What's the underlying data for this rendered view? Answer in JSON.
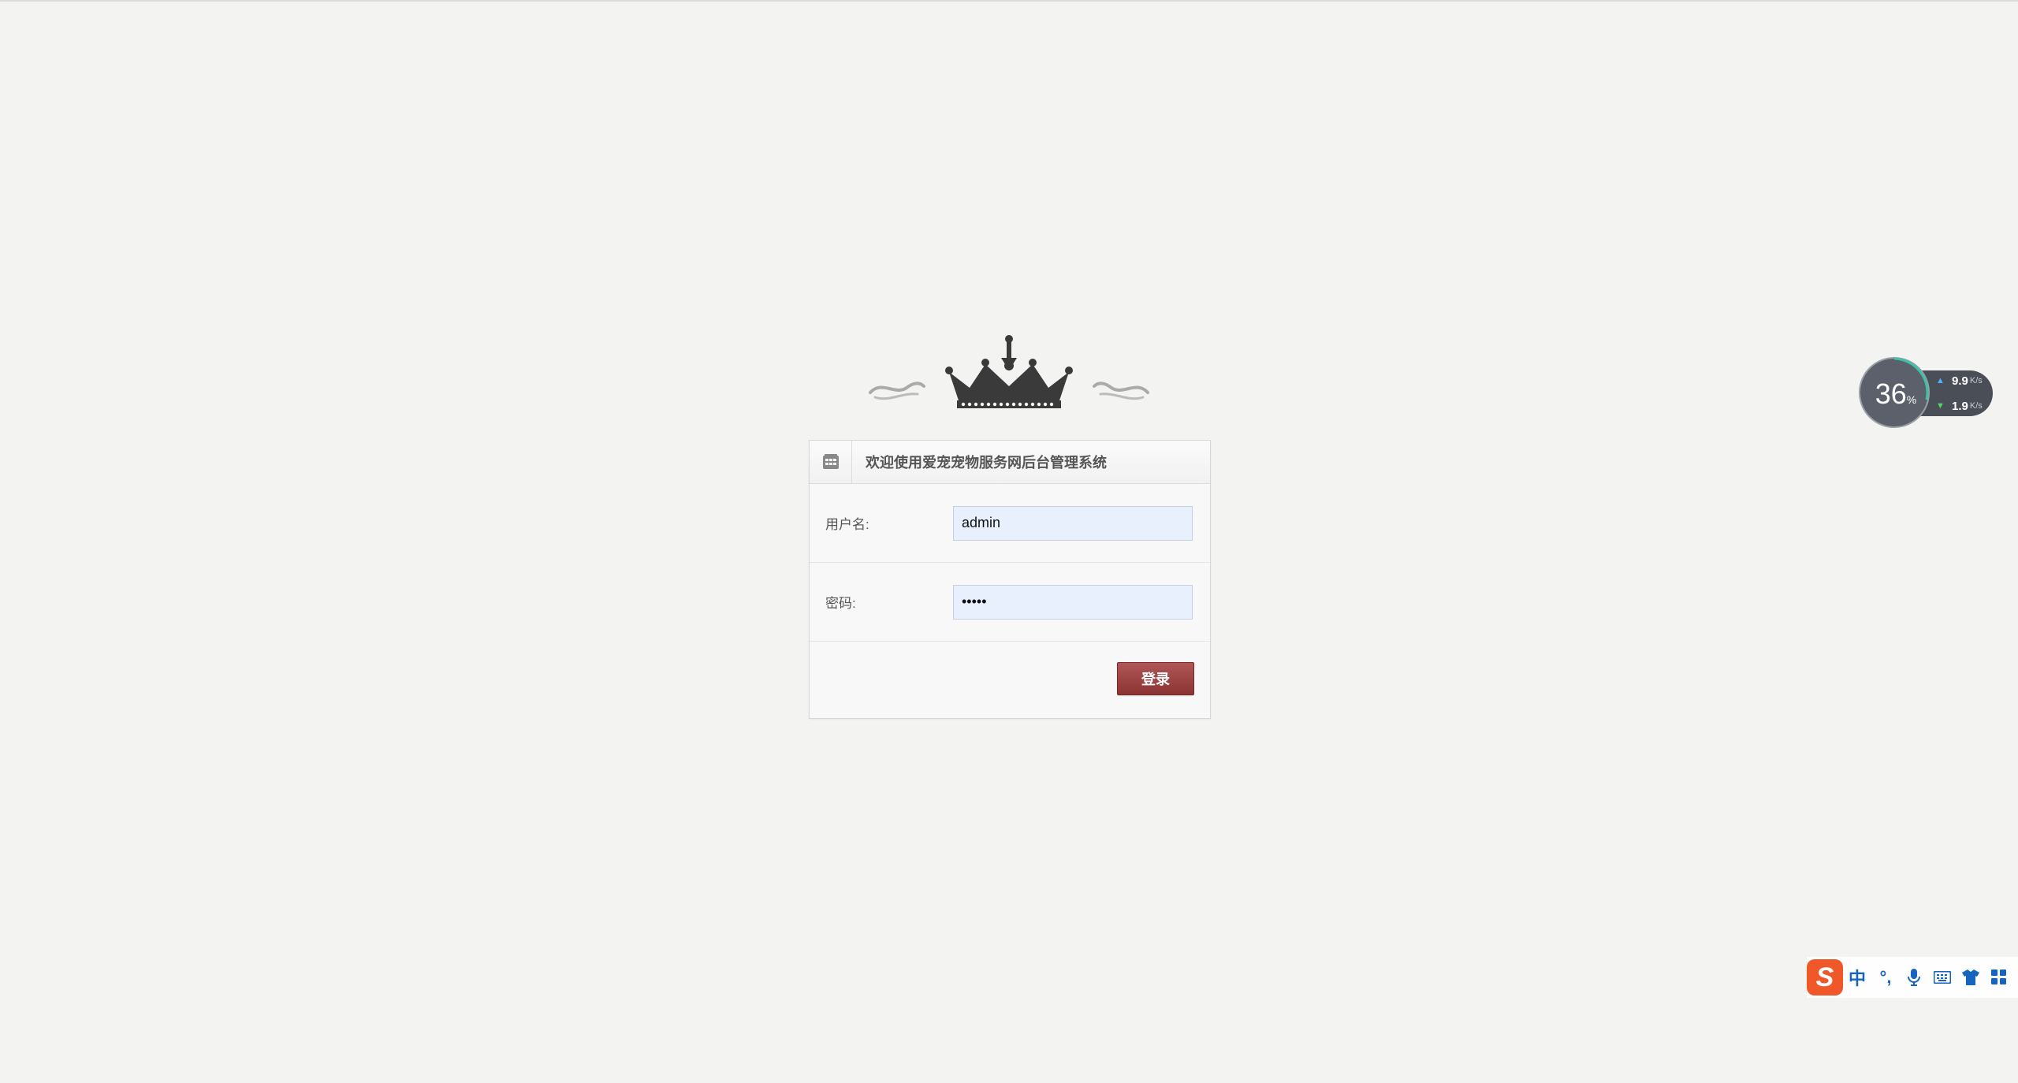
{
  "login": {
    "title": "欢迎使用爱宠宠物服务网后台管理系统",
    "username_label": "用户名:",
    "username_value": "admin",
    "password_label": "密码:",
    "password_value": "•••••",
    "submit_label": "登录"
  },
  "net_widget": {
    "cpu_percent": "36",
    "percent_unit": "%",
    "upload_speed": "9.9",
    "download_speed": "1.9",
    "speed_unit": "K/s"
  },
  "ime": {
    "mode": "中",
    "punct": "°,"
  },
  "colors": {
    "background": "#f3f3f2",
    "button": "#9c4444",
    "input_bg": "#e8f0fe",
    "ime_logo": "#f0582a",
    "ime_icon": "#1565c0"
  }
}
